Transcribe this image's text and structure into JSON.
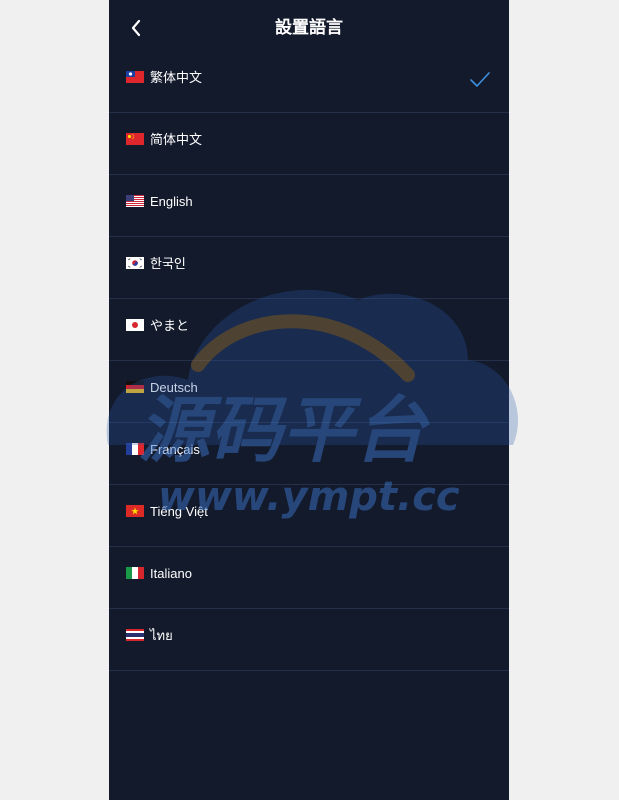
{
  "header": {
    "title": "設置語言"
  },
  "languages": [
    {
      "label": "繁体中文",
      "flag": "taiwan-flag",
      "selected": true
    },
    {
      "label": "简体中文",
      "flag": "china-flag",
      "selected": false
    },
    {
      "label": "English",
      "flag": "us-flag",
      "selected": false
    },
    {
      "label": "한국인",
      "flag": "korea-flag",
      "selected": false
    },
    {
      "label": "やまと",
      "flag": "japan-flag",
      "selected": false
    },
    {
      "label": "Deutsch",
      "flag": "germany-flag",
      "selected": false
    },
    {
      "label": "Français",
      "flag": "france-flag",
      "selected": false
    },
    {
      "label": "Tiếng Việt",
      "flag": "vietnam-flag",
      "selected": false
    },
    {
      "label": "Italiano",
      "flag": "italy-flag",
      "selected": false
    },
    {
      "label": "ไทย",
      "flag": "thailand-flag",
      "selected": false
    }
  ],
  "watermark": {
    "title": "源码平台",
    "url": "www.ympt.cc"
  },
  "colors": {
    "background": "#131a2c",
    "divider": "#24304a",
    "check": "#3d8fe0",
    "page": "#f0f0f0"
  }
}
